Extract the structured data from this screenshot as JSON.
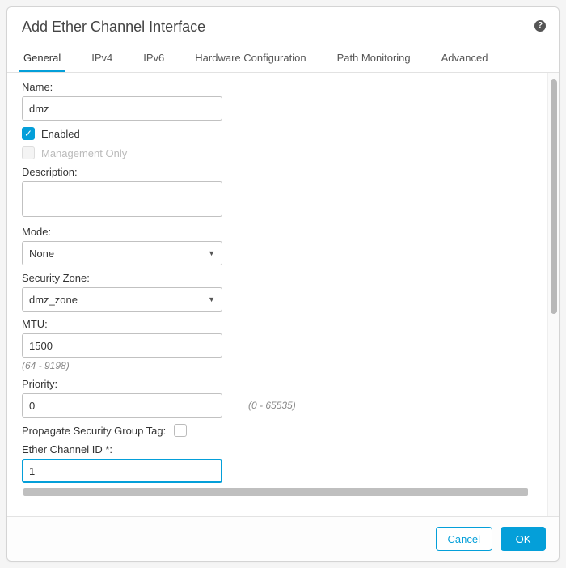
{
  "dialog": {
    "title": "Add Ether Channel Interface"
  },
  "tabs": {
    "general": "General",
    "ipv4": "IPv4",
    "ipv6": "IPv6",
    "hw": "Hardware Configuration",
    "path": "Path Monitoring",
    "advanced": "Advanced"
  },
  "form": {
    "name_label": "Name:",
    "name_value": "dmz",
    "enabled_label": "Enabled",
    "management_only_label": "Management Only",
    "description_label": "Description:",
    "description_value": "",
    "mode_label": "Mode:",
    "mode_value": "None",
    "zone_label": "Security Zone:",
    "zone_value": "dmz_zone",
    "mtu_label": "MTU:",
    "mtu_value": "1500",
    "mtu_hint": "(64 - 9198)",
    "priority_label": "Priority:",
    "priority_value": "0",
    "priority_hint": "(0 - 65535)",
    "propagate_label": "Propagate Security Group Tag:",
    "etherchannel_label": "Ether Channel ID *:",
    "etherchannel_value": "1"
  },
  "footer": {
    "cancel": "Cancel",
    "ok": "OK"
  }
}
